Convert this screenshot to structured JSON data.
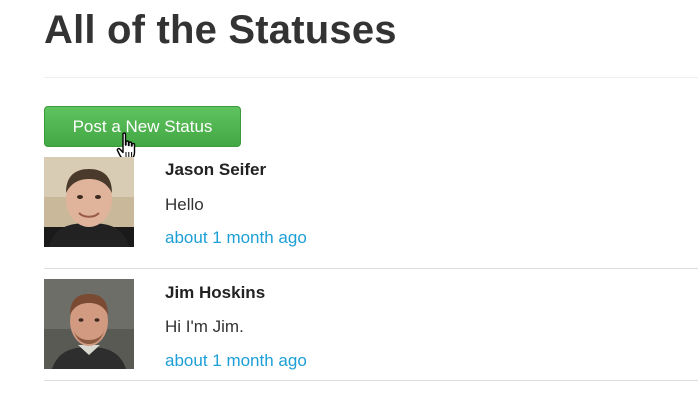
{
  "page": {
    "title": "All of the Statuses"
  },
  "actions": {
    "post_label": "Post a New Status"
  },
  "statuses": [
    {
      "name": "Jason Seifer",
      "content": "Hello",
      "time": "about 1 month ago"
    },
    {
      "name": "Jim Hoskins",
      "content": "Hi I'm Jim.",
      "time": "about 1 month ago"
    }
  ],
  "colors": {
    "button_green": "#4cb34c",
    "link_blue": "#1c9fd6",
    "title_text": "#333333",
    "divider": "#dddddd"
  },
  "icons": {
    "cursor": "hand-pointer-icon"
  }
}
